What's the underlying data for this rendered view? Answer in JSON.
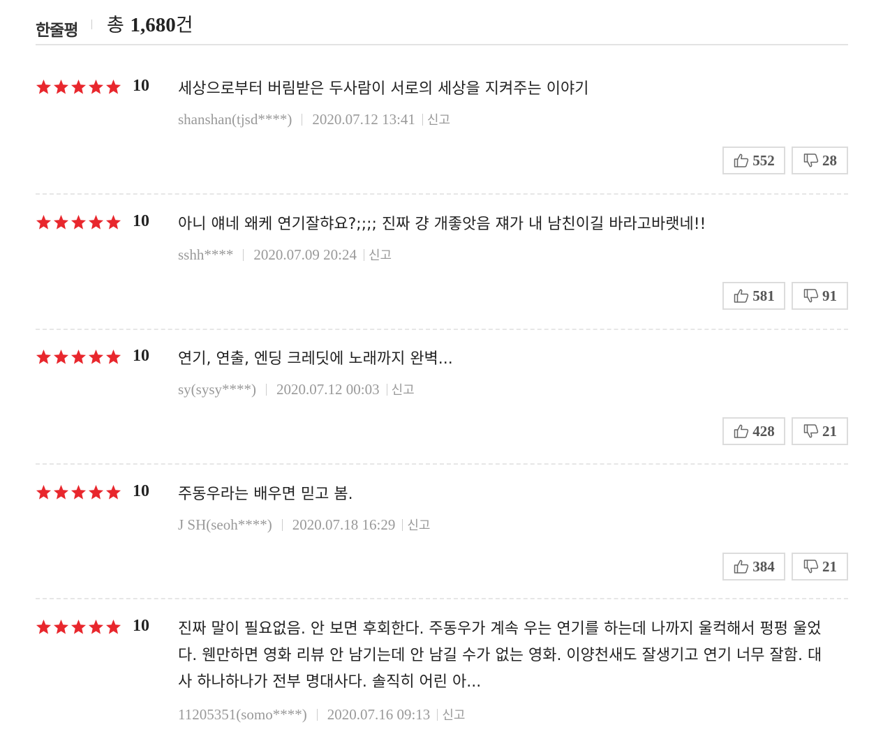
{
  "header": {
    "title": "한줄평",
    "total_prefix": "총 ",
    "total_count": "1,680",
    "total_suffix": "건"
  },
  "star_color": "#e8272d",
  "reviews": [
    {
      "score": "10",
      "text": "세상으로부터 버림받은 두사람이 서로의 세상을 지켜주는 이야기",
      "author": "shanshan(tjsd****)",
      "date": "2020.07.12 13:41",
      "report": "신고",
      "likes": "552",
      "dislikes": "28"
    },
    {
      "score": "10",
      "text": "아니 얘네 왜케 연기잘햐요?;;;; 진짜 걍 개좋앗음 쟤가 내 남친이길 바라고바랫네!!",
      "author": "sshh****",
      "date": "2020.07.09 20:24",
      "report": "신고",
      "likes": "581",
      "dislikes": "91"
    },
    {
      "score": "10",
      "text": "연기, 연출, 엔딩 크레딧에 노래까지 완벽...",
      "author": "sy(sysy****)",
      "date": "2020.07.12 00:03",
      "report": "신고",
      "likes": "428",
      "dislikes": "21"
    },
    {
      "score": "10",
      "text": "주동우라는 배우면 믿고 봄.",
      "author": "J SH(seoh****)",
      "date": "2020.07.18 16:29",
      "report": "신고",
      "likes": "384",
      "dislikes": "21"
    },
    {
      "score": "10",
      "text": "진짜 말이 필요없음. 안 보면 후회한다. 주동우가 계속 우는 연기를 하는데 나까지 울컥해서 펑펑 울었다. 웬만하면 영화 리뷰 안 남기는데 안 남길 수가 없는 영화. 이양천새도 잘생기고 연기 너무 잘함. 대사 하나하나가 전부 명대사다. 솔직히 어린 아...",
      "author": "11205351(somo****)",
      "date": "2020.07.16 09:13",
      "report": "신고"
    }
  ]
}
